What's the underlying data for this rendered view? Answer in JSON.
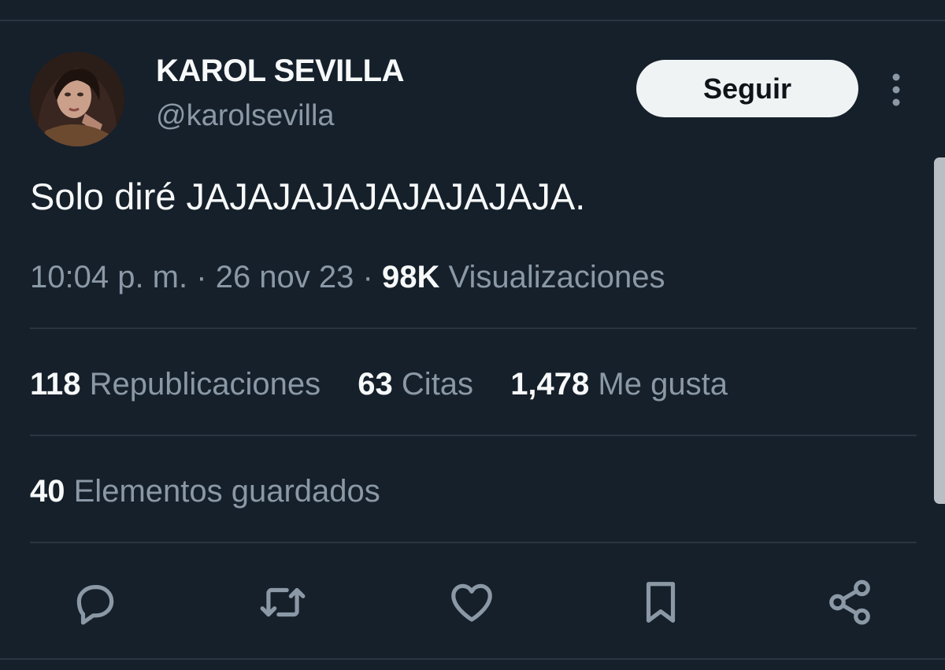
{
  "profile": {
    "display_name": "KAROL SEVILLA",
    "handle": "@karolsevilla"
  },
  "follow_button": {
    "label": "Seguir"
  },
  "tweet": {
    "text": "Solo diré JAJAJAJAJAJAJAJAJA."
  },
  "meta": {
    "time": "10:04 p. m.",
    "separator": "·",
    "date": "26 nov 23",
    "views_count": "98K",
    "views_label": "Visualizaciones"
  },
  "stats": [
    {
      "count": "118",
      "label": "Republicaciones"
    },
    {
      "count": "63",
      "label": "Citas"
    },
    {
      "count": "1,478",
      "label": "Me gusta"
    }
  ],
  "saved": {
    "count": "40",
    "label": "Elementos guardados"
  },
  "actions": [
    "reply-icon",
    "retweet-icon",
    "like-icon",
    "bookmark-icon",
    "share-icon"
  ],
  "colors": {
    "background": "#15202b",
    "text_primary": "#f7f9f9",
    "text_secondary": "#8b98a5",
    "divider": "#2a3541",
    "button_bg": "#eff3f4"
  }
}
